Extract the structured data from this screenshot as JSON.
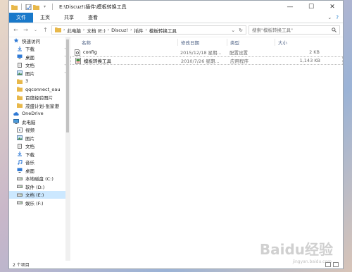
{
  "window": {
    "title": "E:\\Discuz!\\插件\\模板转换工具",
    "controls": {
      "minimize": "—",
      "maximize": "☐",
      "close": "✕"
    }
  },
  "ribbon": {
    "tabs": [
      "文件",
      "主页",
      "共享",
      "查看"
    ],
    "expand": "⌄",
    "help": "?"
  },
  "address": {
    "crumbs": [
      "此电脑",
      "文档 (E:)",
      "Discuz!",
      "插件",
      "模板转换工具"
    ],
    "search_placeholder": "搜索\"模板转换工具\""
  },
  "nav": {
    "items": [
      {
        "label": "快速访问",
        "icon": "star-icon",
        "level": 1
      },
      {
        "label": "下载",
        "icon": "download-icon",
        "level": 2,
        "pinned": true
      },
      {
        "label": "桌面",
        "icon": "desktop-icon",
        "level": 2,
        "pinned": true
      },
      {
        "label": "文档",
        "icon": "document-icon",
        "level": 2,
        "pinned": true
      },
      {
        "label": "图片",
        "icon": "picture-icon",
        "level": 2,
        "pinned": true
      },
      {
        "label": "3",
        "icon": "folder-icon",
        "level": 2
      },
      {
        "label": "qqconnect_oau",
        "icon": "folder-icon",
        "level": 2
      },
      {
        "label": "百度经验图片",
        "icon": "folder-icon",
        "level": 2
      },
      {
        "label": "茂盛计划-张家港",
        "icon": "folder-icon",
        "level": 2
      },
      {
        "label": "OneDrive",
        "icon": "cloud-icon",
        "level": 1,
        "gap": true
      },
      {
        "label": "此电脑",
        "icon": "computer-icon",
        "level": 1,
        "gap": true
      },
      {
        "label": "视频",
        "icon": "video-icon",
        "level": 2
      },
      {
        "label": "图片",
        "icon": "picture-icon",
        "level": 2
      },
      {
        "label": "文档",
        "icon": "document-icon",
        "level": 2
      },
      {
        "label": "下载",
        "icon": "download-icon",
        "level": 2
      },
      {
        "label": "音乐",
        "icon": "music-icon",
        "level": 2
      },
      {
        "label": "桌面",
        "icon": "desktop-icon",
        "level": 2
      },
      {
        "label": "本地磁盘 (C:)",
        "icon": "drive-icon",
        "level": 2
      },
      {
        "label": "软件 (D:)",
        "icon": "drive-icon",
        "level": 2
      },
      {
        "label": "文档 (E:)",
        "icon": "drive-icon",
        "level": 2,
        "selected": true
      },
      {
        "label": "娱乐 (F:)",
        "icon": "drive-icon",
        "level": 2
      }
    ]
  },
  "files": {
    "columns": {
      "name": "名称",
      "date": "修改日期",
      "type": "类型",
      "size": "大小"
    },
    "rows": [
      {
        "name": "config",
        "date": "2015/12/18 星期...",
        "type": "配置设置",
        "size": "2 KB",
        "icon": "config-file-icon"
      },
      {
        "name": "模板转换工具",
        "date": "2010/7/26 星期...",
        "type": "应用程序",
        "size": "1,143 KB",
        "icon": "app-icon",
        "selected": true
      }
    ]
  },
  "status": {
    "text": "2 个项目"
  },
  "watermark": {
    "text": "Baidu经验",
    "sub": "jingyan.baidu.com"
  },
  "colors": {
    "accent": "#1979ca",
    "selection": "#cce8ff",
    "header_text": "#4d6185"
  }
}
